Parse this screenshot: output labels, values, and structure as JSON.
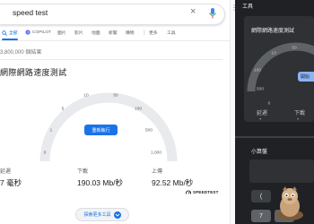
{
  "search": {
    "query": "speed test",
    "clear_glyph": "×",
    "mic_icon": "mic-icon"
  },
  "tabs": [
    {
      "label": "全部",
      "icon": "search-icon",
      "active": true
    },
    {
      "label": "COPILOT",
      "icon": "copilot-icon"
    },
    {
      "label": "圖片"
    },
    {
      "label": "影片"
    },
    {
      "label": "地圖"
    },
    {
      "label": "新聞"
    },
    {
      "label": "購物"
    },
    {
      "label": "更多"
    },
    {
      "label": "工具"
    }
  ],
  "results_count": "3,800,000 個結果",
  "speedtest": {
    "title": "網際網路速度測試",
    "gauge_labels": [
      "1",
      "5",
      "10",
      "50",
      "100",
      "500",
      "1,000",
      "0"
    ],
    "start_label": "重新執行",
    "latency_label": "延遲",
    "latency_value": "7 毫秒",
    "download_label": "下載",
    "download_value": "190.03 Mb/秒",
    "upload_label": "上傳",
    "upload_value": "92.52 Mb/秒",
    "powered_by": "SPEEDTEST",
    "more_tools": "探索更多工具"
  },
  "side_panel": {
    "window_title": "工具",
    "card_title": "網際網路速度測試",
    "gauge_labels": [
      "10",
      "50",
      "100",
      "500",
      "0"
    ],
    "start_label": "開始",
    "latency_label": "延遲",
    "latency_value": "-",
    "download_label": "下載",
    "download_value": "-",
    "calc_title": "小算盤",
    "calc_keys": [
      "(",
      "7",
      "8"
    ]
  },
  "colors": {
    "accent": "#1a73e8",
    "dark_bg": "#202124",
    "dark_card": "#303134",
    "dark_accent": "#8ab4f8"
  }
}
